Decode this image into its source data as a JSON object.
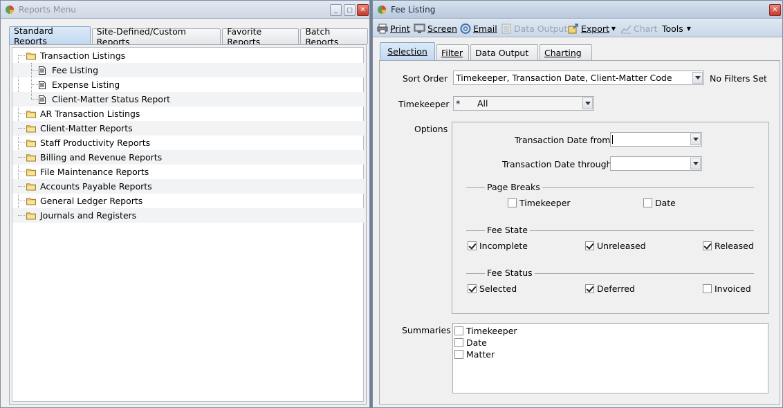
{
  "left_window": {
    "title": "Reports Menu",
    "tabs": [
      "Standard Reports",
      "Site-Defined/Custom Reports",
      "Favorite Reports",
      "Batch Reports"
    ],
    "tree": [
      {
        "label": "Transaction Listings",
        "type": "folder",
        "level": 0
      },
      {
        "label": "Fee Listing",
        "type": "document",
        "level": 1
      },
      {
        "label": "Expense Listing",
        "type": "document",
        "level": 1
      },
      {
        "label": "Client-Matter Status Report",
        "type": "document",
        "level": 1
      },
      {
        "label": "AR Transaction Listings",
        "type": "folder",
        "level": 0
      },
      {
        "label": "Client-Matter Reports",
        "type": "folder",
        "level": 0
      },
      {
        "label": "Staff Productivity Reports",
        "type": "folder",
        "level": 0
      },
      {
        "label": "Billing and Revenue Reports",
        "type": "folder",
        "level": 0
      },
      {
        "label": "File Maintenance Reports",
        "type": "folder",
        "level": 0
      },
      {
        "label": "Accounts Payable Reports",
        "type": "folder",
        "level": 0
      },
      {
        "label": "General Ledger Reports",
        "type": "folder",
        "level": 0
      },
      {
        "label": "Journals and Registers",
        "type": "folder",
        "level": 0
      }
    ]
  },
  "right_window": {
    "title": "Fee Listing",
    "toolbar": {
      "print": "Print",
      "screen": "Screen",
      "email": "Email",
      "data_output": "Data Output",
      "export": "Export",
      "chart": "Chart",
      "tools": "Tools"
    },
    "tabs": [
      "Selection",
      "Filter",
      "Data Output",
      "Charting"
    ],
    "sort_order_label": "Sort Order",
    "sort_order_value": "Timekeeper, Transaction Date, Client-Matter Code",
    "no_filters": "No Filters Set",
    "timekeeper_label": "Timekeeper",
    "timekeeper_code": "*",
    "timekeeper_value": "All",
    "options_label": "Options",
    "date_from_label": "Transaction Date from",
    "date_through_label": "Transaction Date through",
    "page_breaks": {
      "title": "Page Breaks",
      "timekeeper": "Timekeeper",
      "date": "Date"
    },
    "fee_state": {
      "title": "Fee State",
      "incomplete": "Incomplete",
      "unreleased": "Unreleased",
      "released": "Released"
    },
    "fee_status": {
      "title": "Fee Status",
      "selected": "Selected",
      "deferred": "Deferred",
      "invoiced": "Invoiced"
    },
    "summaries_label": "Summaries",
    "summaries": [
      "Timekeeper",
      "Date",
      "Matter"
    ]
  },
  "colors": {
    "desktop": "#6e7f96",
    "active_tab": "#c2d8f0",
    "folder": "#e8c25a"
  }
}
